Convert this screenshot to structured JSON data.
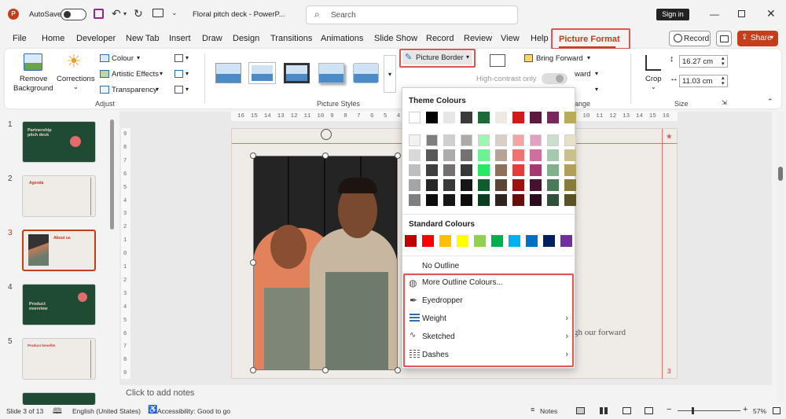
{
  "titlebar": {
    "autosave": "AutoSave",
    "filename": "Floral pitch deck  -  PowerP...",
    "search_placeholder": "Search",
    "sign_in": "Sign in"
  },
  "menu": {
    "items": [
      "File",
      "Home",
      "Developer",
      "New Tab",
      "Insert",
      "Draw",
      "Design",
      "Transitions",
      "Animations",
      "Slide Show",
      "Record",
      "Review",
      "View",
      "Help",
      "Picture Format"
    ],
    "record": "Record",
    "share": "Share"
  },
  "ribbon": {
    "remove_background_1": "Remove",
    "remove_background_2": "Background",
    "corrections": "Corrections",
    "colour": "Colour",
    "artistic_effects": "Artistic Effects",
    "transparency": "Transparency",
    "adjust_label": "Adjust",
    "picture_styles_label": "Picture Styles",
    "picture_border": "Picture Border",
    "high_contrast": "High-contrast only",
    "bring_forward": "Bring Forward",
    "ward": "ward",
    "range": "ange",
    "crop": "Crop",
    "height": "16.27 cm",
    "width": "11.03 cm",
    "size_label": "Size"
  },
  "ruler": {
    "top": [
      "16",
      "15",
      "14",
      "13",
      "12",
      "11",
      "10",
      "9",
      "8",
      "7",
      "6",
      "5",
      "4",
      "3",
      "2",
      "1",
      "0",
      "1",
      "2",
      "3",
      "4",
      "5",
      "6",
      "7",
      "8",
      "9",
      "10",
      "11",
      "12",
      "13",
      "14",
      "15",
      "16"
    ],
    "left": [
      "9",
      "8",
      "7",
      "6",
      "5",
      "4",
      "3",
      "2",
      "1",
      "0",
      "1",
      "2",
      "3",
      "4",
      "5",
      "6",
      "7",
      "8",
      "9"
    ]
  },
  "thumbs": [
    {
      "num": "1",
      "title": "Partnership pitch deck",
      "bg": "#1f4a33",
      "fg": "#e8d9c6"
    },
    {
      "num": "2",
      "title": "Agenda",
      "bg": "#efebe7",
      "fg": "#c0392b"
    },
    {
      "num": "3",
      "title": "About us",
      "bg": "#efebe7",
      "fg": "#c0392b"
    },
    {
      "num": "4",
      "title": "Product overview",
      "bg": "#1f4a33",
      "fg": "#e8d9c6"
    },
    {
      "num": "5",
      "title": "Product benefits",
      "bg": "#efebe7",
      "fg": "#c0392b"
    }
  ],
  "slide": {
    "partial_text": "gh our forward",
    "page_number": "3",
    "asterisk": "*"
  },
  "notes_placeholder": "Click to add notes",
  "dropdown": {
    "theme_colours": "Theme Colours",
    "standard_colours": "Standard Colours",
    "no_outline": "No Outline",
    "more_outline": "More Outline Colours...",
    "eyedropper": "Eyedropper",
    "weight": "Weight",
    "sketched": "Sketched",
    "dashes": "Dashes",
    "theme_top": [
      "#ffffff",
      "#000000",
      "#e7e6e6",
      "#3b3b3b",
      "#1e6b3a",
      "#ede9e5",
      "#d11a1a",
      "#5c1a3f",
      "#7a2a5a",
      "#b8ac5a"
    ],
    "theme_shades": [
      [
        "#f2f2f2",
        "#7f7f7f",
        "#d0cece",
        "#aeaaaa",
        "#9ff5b4",
        "#d9cfc7",
        "#f5a3a3",
        "#e3a0c2",
        "#c9e0cf",
        "#e5e0c6"
      ],
      [
        "#d9d9d9",
        "#595959",
        "#aeabab",
        "#757171",
        "#6ef191",
        "#b5a396",
        "#ee7373",
        "#cf6e9f",
        "#a6c9ae",
        "#cac08e"
      ],
      [
        "#bfbfbf",
        "#3f3f3f",
        "#757070",
        "#3a3838",
        "#2be862",
        "#8e6f5a",
        "#e43b3b",
        "#a43a70",
        "#7fb18c",
        "#b0a156"
      ],
      [
        "#a5a5a5",
        "#262626",
        "#3a3838",
        "#171616",
        "#115c2e",
        "#5a4537",
        "#9c1212",
        "#451330",
        "#4b7a58",
        "#877c3b"
      ],
      [
        "#7f7f7f",
        "#0c0c0c",
        "#171616",
        "#0c0c0c",
        "#0b3d1e",
        "#2d2320",
        "#680c0c",
        "#2e0c20",
        "#324f3a",
        "#5a5227"
      ]
    ],
    "standard": [
      "#c00000",
      "#ff0000",
      "#ffc000",
      "#ffff00",
      "#92d050",
      "#00b050",
      "#00b0f0",
      "#0070c0",
      "#002060",
      "#7030a0"
    ]
  },
  "statusbar": {
    "slide": "Slide 3 of 13",
    "language": "English (United States)",
    "accessibility": "Accessibility: Good to go",
    "notes": "Notes",
    "zoom": "57%"
  },
  "colors": {
    "accent": "#c43e1c",
    "highlight": "#e05454",
    "green_dark": "#1f4a33"
  }
}
